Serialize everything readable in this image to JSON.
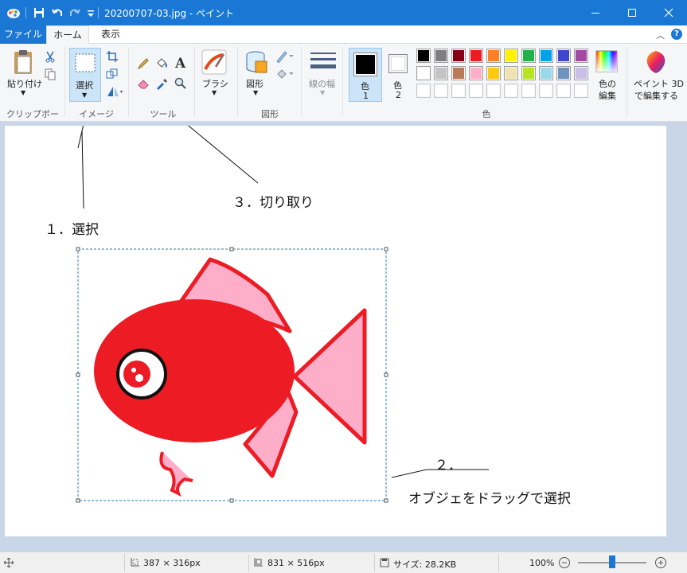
{
  "window": {
    "title": "20200707-03.jpg - ペイント"
  },
  "tabs": {
    "file": "ファイル",
    "home": "ホーム",
    "view": "表示"
  },
  "ribbon": {
    "clipboard": {
      "paste": "貼り付け",
      "group": "クリップボード"
    },
    "image": {
      "select": "選択",
      "group": "イメージ"
    },
    "tools": {
      "group": "ツール"
    },
    "brushes": {
      "label": "ブラシ"
    },
    "shapes": {
      "label": "図形",
      "group": "図形"
    },
    "size": {
      "label": "線の幅"
    },
    "colors": {
      "color1": "色",
      "color1_num": "1",
      "color2": "色",
      "color2_num": "2",
      "edit_line1": "色の",
      "edit_line2": "編集",
      "group": "色",
      "palette_row1": [
        "#000000",
        "#7f7f7f",
        "#880015",
        "#ed1c24",
        "#ff7f27",
        "#fff200",
        "#22b14c",
        "#00a2e8",
        "#3f48cc",
        "#a349a4"
      ],
      "palette_row2": [
        "#ffffff",
        "#c3c3c3",
        "#b97a57",
        "#ffaec9",
        "#ffc90e",
        "#efe4b0",
        "#b5e61d",
        "#99d9ea",
        "#7092be",
        "#c8bfe7"
      ],
      "palette_row3": [
        "",
        "",
        "",
        "",
        "",
        "",
        "",
        "",
        "",
        ""
      ],
      "primary": "#000000",
      "secondary": "#ffffff"
    },
    "paint3d": {
      "line1": "ペイント 3D",
      "line2": "で編集する"
    }
  },
  "annotations": {
    "select": "１．選択",
    "crop": "３．切り取り",
    "step2_num": "２．",
    "step2_text": "オブジェをドラッグで選択"
  },
  "status": {
    "selection_size": "387 × 316px",
    "image_size": "831 × 516px",
    "file_size": "サイズ: 28.2KB",
    "zoom": "100%"
  },
  "colors": {
    "accent": "#1a78d4",
    "fish_body": "#ed1c24",
    "fish_fin": "#ffaec9"
  }
}
